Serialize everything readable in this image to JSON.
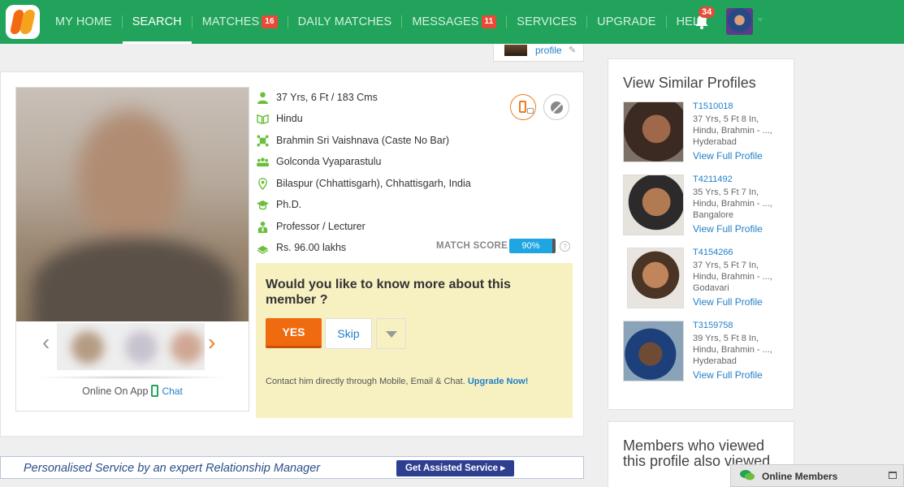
{
  "nav": {
    "items": [
      {
        "label": "MY HOME"
      },
      {
        "label": "SEARCH"
      },
      {
        "label": "MATCHES",
        "badge": "16"
      },
      {
        "label": "DAILY MATCHES"
      },
      {
        "label": "MESSAGES",
        "badge": "11"
      },
      {
        "label": "SERVICES"
      },
      {
        "label": "UPGRADE"
      },
      {
        "label": "HELP"
      }
    ],
    "active": "SEARCH",
    "notifications_badge": "34",
    "brand_color": "#21a35b"
  },
  "top_tab": {
    "link": "profile"
  },
  "profile": {
    "details": [
      {
        "icon": "person-icon",
        "text": "37 Yrs, 6 Ft / 183 Cms"
      },
      {
        "icon": "religion-icon",
        "text": "Hindu"
      },
      {
        "icon": "caste-icon",
        "text": "Brahmin Sri Vaishnava (Caste No Bar)"
      },
      {
        "icon": "community-icon",
        "text": "Golconda Vyaparastulu"
      },
      {
        "icon": "location-icon",
        "text": "Bilaspur (Chhattisgarh), Chhattisgarh, India"
      },
      {
        "icon": "education-icon",
        "text": "Ph.D."
      },
      {
        "icon": "profession-icon",
        "text": "Professor / Lecturer"
      },
      {
        "icon": "income-icon",
        "text": "Rs. 96.00 lakhs"
      }
    ],
    "match_score_label": "MATCH SCORE",
    "match_score": "90%",
    "online_text": "Online On App",
    "chat_label": "Chat"
  },
  "ask": {
    "question": "Would you like to know more about this member ?",
    "yes": "YES",
    "skip": "Skip",
    "contact_text": "Contact him directly through Mobile, Email & Chat.",
    "upgrade_link": "Upgrade Now!"
  },
  "banner": {
    "text": "Personalised Service by an expert Relationship Manager",
    "button": "Get Assisted Service ▸"
  },
  "similar": {
    "title": "View Similar Profiles",
    "items": [
      {
        "id": "T1510018",
        "line1": "37 Yrs, 5 Ft 8 In,",
        "line2": "Hindu, Brahmin - ...,",
        "line3": "Hyderabad",
        "view": "View Full Profile"
      },
      {
        "id": "T4211492",
        "line1": "35 Yrs, 5 Ft 7 In,",
        "line2": "Hindu, Brahmin - ...,",
        "line3": "Bangalore",
        "view": "View Full Profile"
      },
      {
        "id": "T4154266",
        "line1": "37 Yrs, 5 Ft 7 In,",
        "line2": "Hindu, Brahmin - ...,",
        "line3": "Godavari",
        "view": "View Full Profile"
      },
      {
        "id": "T3159758",
        "line1": "39 Yrs, 5 Ft 8 In,",
        "line2": "Hindu, Brahmin - ...,",
        "line3": "Hyderabad",
        "view": "View Full Profile"
      }
    ]
  },
  "viewed": {
    "title": "Members who viewed this profile also viewed"
  },
  "online_members": {
    "label": "Online Members"
  }
}
